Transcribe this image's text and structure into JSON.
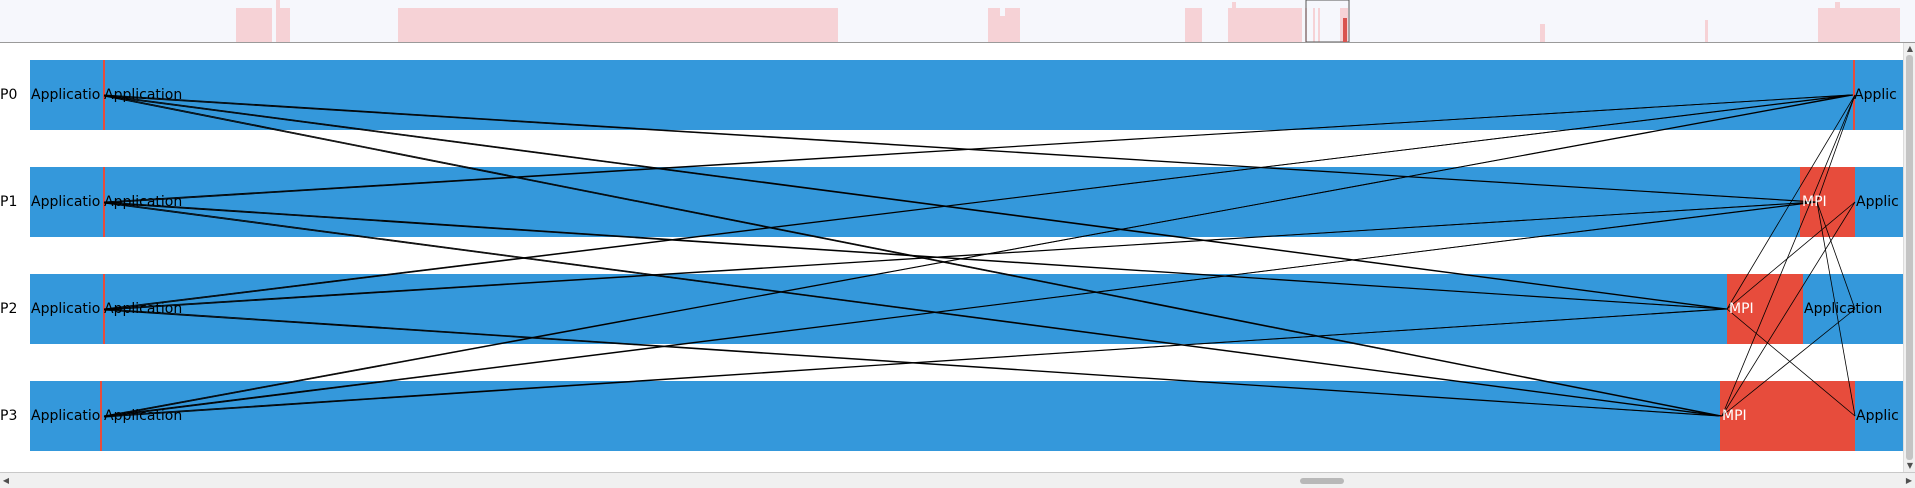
{
  "colors": {
    "application": "#3498db",
    "mpi": "#e74c3c",
    "overview_bg": "#f6f7fc",
    "overview_bar": "#f6d2d6",
    "message_line": "#000000"
  },
  "processes": [
    {
      "label": "P0",
      "segments": [
        {
          "type": "application",
          "label": "Applicatio"
        },
        {
          "type": "application",
          "label": "Application"
        },
        {
          "type": "application",
          "label": "Applic"
        }
      ]
    },
    {
      "label": "P1",
      "segments": [
        {
          "type": "application",
          "label": "Applicatio"
        },
        {
          "type": "application",
          "label": "Application"
        },
        {
          "type": "mpi",
          "label": "MPI"
        },
        {
          "type": "application",
          "label": "Applic"
        }
      ]
    },
    {
      "label": "P2",
      "segments": [
        {
          "type": "application",
          "label": "Applicatio"
        },
        {
          "type": "application",
          "label": "Application"
        },
        {
          "type": "mpi",
          "label": "MPI"
        },
        {
          "type": "application",
          "label": "Application"
        }
      ]
    },
    {
      "label": "P3",
      "segments": [
        {
          "type": "application",
          "label": "Applicatio"
        },
        {
          "type": "application",
          "label": "Application"
        },
        {
          "type": "mpi",
          "label": "MPI"
        },
        {
          "type": "application",
          "label": "Applic"
        }
      ]
    }
  ],
  "scrollbars": {
    "up_arrow": "▲",
    "down_arrow": "▼",
    "left_arrow": "◀",
    "right_arrow": "▶"
  }
}
